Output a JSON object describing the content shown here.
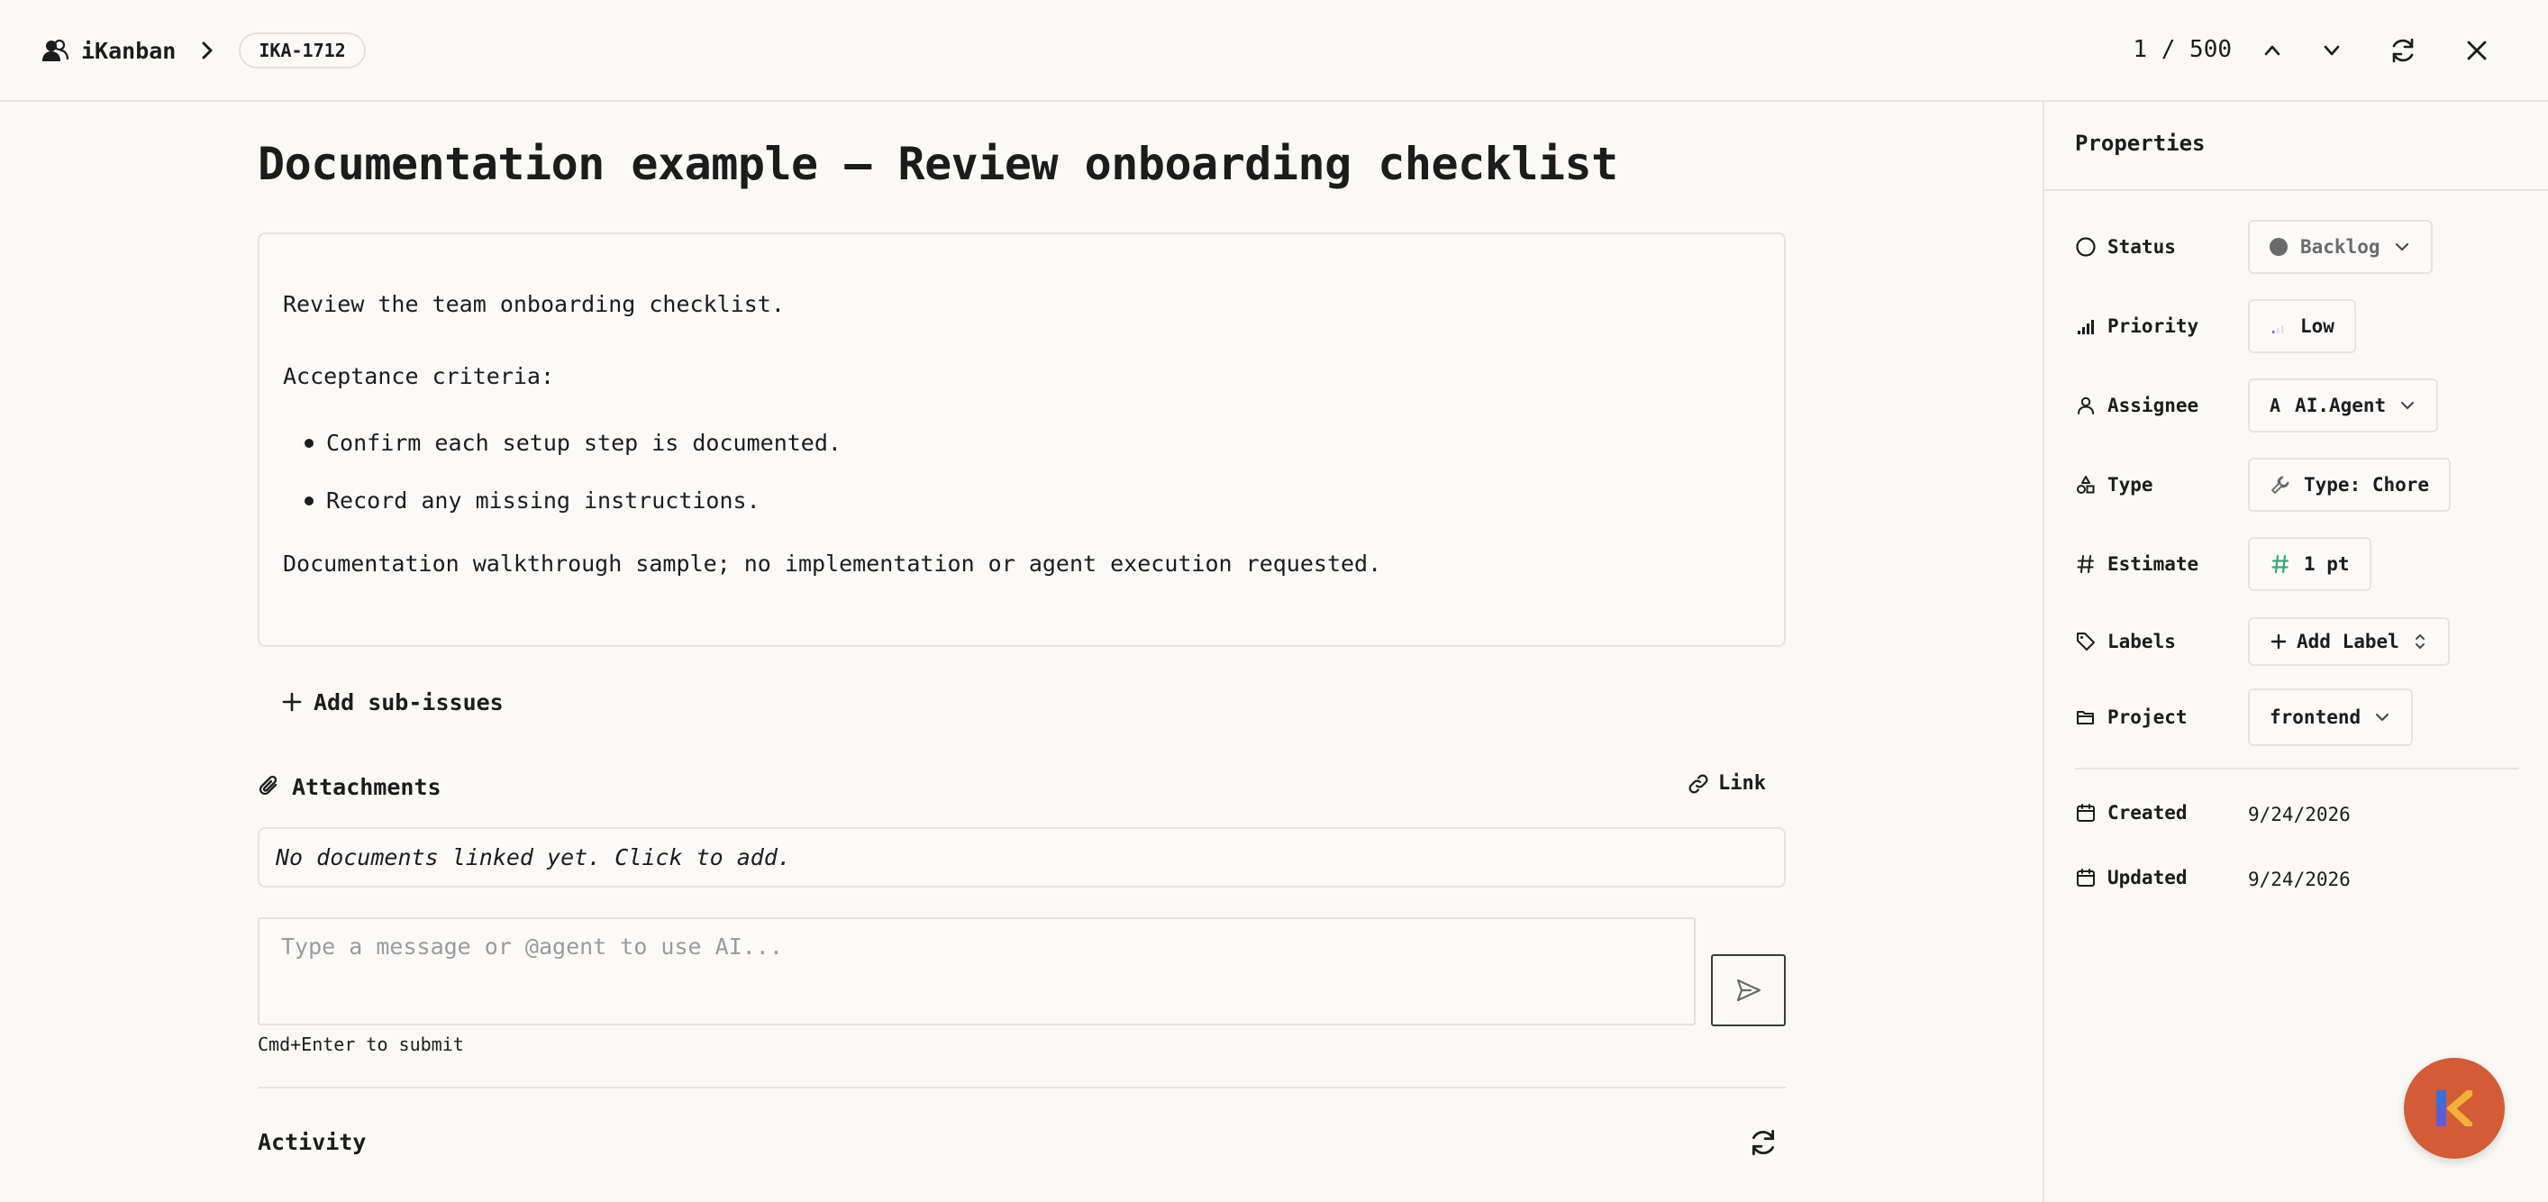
{
  "header": {
    "app_name": "iKanban",
    "issue_id": "IKA-1712",
    "pager": "1 / 500"
  },
  "issue": {
    "title": "Documentation example — Review onboarding checklist",
    "description": {
      "intro": "Review the team onboarding checklist.",
      "criteria_heading": "Acceptance criteria:",
      "bullets": [
        "Confirm each setup step is documented.",
        "Record any missing instructions."
      ],
      "note": "Documentation walkthrough sample; no implementation or agent execution requested."
    },
    "add_subissues_label": "Add sub-issues"
  },
  "attachments": {
    "title": "Attachments",
    "link_label": "Link",
    "empty_text": "No documents linked yet. Click to add."
  },
  "composer": {
    "placeholder": "Type a message or @agent to use AI...",
    "hint": "Cmd+Enter to submit"
  },
  "activity": {
    "title": "Activity"
  },
  "properties": {
    "title": "Properties",
    "status": {
      "label": "Status",
      "value": "Backlog",
      "dot_color": "#6b6b6b"
    },
    "priority": {
      "label": "Priority",
      "value": "Low"
    },
    "assignee": {
      "label": "Assignee",
      "initial": "A",
      "value": "AI.Agent"
    },
    "type": {
      "label": "Type",
      "value": "Type: Chore"
    },
    "estimate": {
      "label": "Estimate",
      "value": "1 pt",
      "icon_color": "#3aa876"
    },
    "labels": {
      "label": "Labels",
      "value": "Add Label"
    },
    "project": {
      "label": "Project",
      "value": "frontend"
    },
    "created": {
      "label": "Created",
      "value": "9/24/2026"
    },
    "updated": {
      "label": "Updated",
      "value": "9/24/2026"
    }
  },
  "colors": {
    "background": "#faf9f6",
    "border": "#e6e4df",
    "fab": "#d35c36",
    "text": "#1c1c1c"
  }
}
